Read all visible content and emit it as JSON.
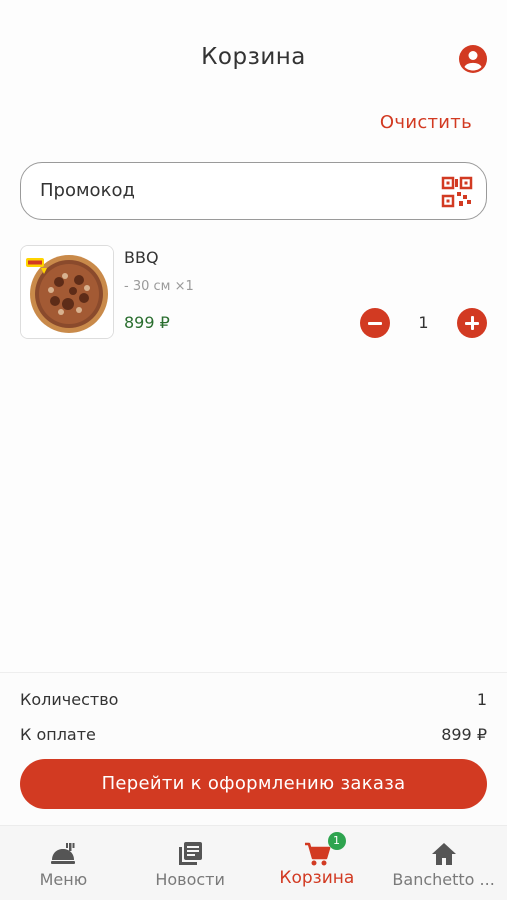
{
  "header": {
    "title": "Корзина"
  },
  "actions": {
    "clear_label": "Очистить"
  },
  "promo": {
    "placeholder": "Промокод"
  },
  "cart": {
    "items": [
      {
        "name": "BBQ",
        "options": "- 30 см ×1",
        "price": "899 ₽",
        "quantity": "1"
      }
    ]
  },
  "summary": {
    "count_label": "Количество",
    "count_value": "1",
    "total_label": "К оплате",
    "total_value": "899 ₽",
    "checkout_label": "Перейти к оформлению заказа"
  },
  "tabbar": {
    "tabs": [
      {
        "label": "Меню",
        "icon": "menu-dish-icon"
      },
      {
        "label": "Новости",
        "icon": "news-icon"
      },
      {
        "label": "Корзина",
        "icon": "cart-icon",
        "badge": "1",
        "active": true
      },
      {
        "label": "Banchetto ...",
        "icon": "home-icon"
      }
    ]
  },
  "colors": {
    "accent": "#d23a22",
    "price": "#2a6e2f",
    "badge": "#2ea44f"
  }
}
